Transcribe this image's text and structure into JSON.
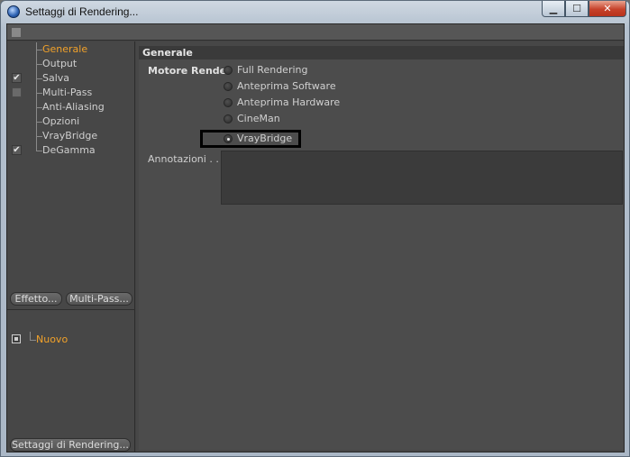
{
  "window": {
    "title": "Settaggi di Rendering...",
    "controls": {
      "minimize": "▁",
      "maximize": "☐",
      "close": "✕"
    }
  },
  "sidebar": {
    "items": [
      {
        "label": "Generale",
        "active": true,
        "check": "none"
      },
      {
        "label": "Output",
        "active": false,
        "check": "none"
      },
      {
        "label": "Salva",
        "active": false,
        "check": "checked"
      },
      {
        "label": "Multi-Pass",
        "active": false,
        "check": "empty"
      },
      {
        "label": "Anti-Aliasing",
        "active": false,
        "check": "none"
      },
      {
        "label": "Opzioni",
        "active": false,
        "check": "none"
      },
      {
        "label": "VrayBridge",
        "active": false,
        "check": "none"
      },
      {
        "label": "DeGamma",
        "active": false,
        "check": "checked"
      }
    ],
    "buttons": {
      "effetto": "Effetto...",
      "multipass": "Multi-Pass..."
    },
    "preset": {
      "label": "Nuovo"
    },
    "footer_button": "Settaggi di Rendering..."
  },
  "main": {
    "section_title": "Generale",
    "engine_label": "Motore Render",
    "engines": [
      {
        "label": "Full Rendering",
        "selected": false
      },
      {
        "label": "Anteprima Software",
        "selected": false
      },
      {
        "label": "Anteprima Hardware",
        "selected": false
      },
      {
        "label": "CineMan",
        "selected": false
      },
      {
        "label": "VrayBridge",
        "selected": true
      }
    ],
    "notes_label": "Annotazioni . . . .",
    "notes_value": ""
  },
  "colors": {
    "accent": "#f2a22a",
    "panel": "#474747",
    "highlight_border": "#000000"
  }
}
